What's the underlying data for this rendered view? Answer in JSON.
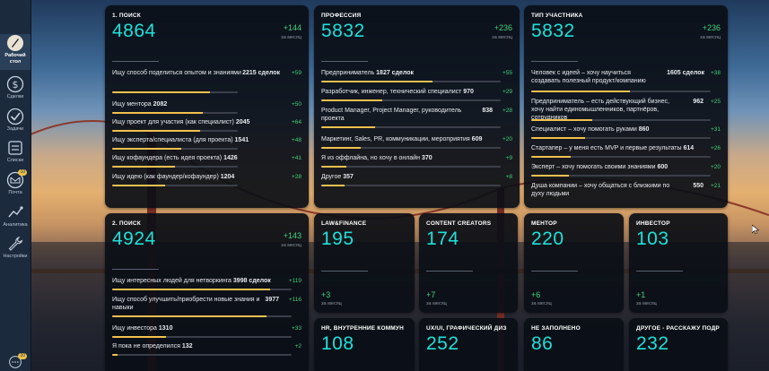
{
  "sidebar": {
    "items": [
      {
        "label": "Рабочий стол",
        "icon": "workspace-avatar-icon",
        "active": true
      },
      {
        "label": "Сделки",
        "icon": "dollar-icon"
      },
      {
        "label": "Задачи",
        "icon": "check-circle-icon"
      },
      {
        "label": "Списки",
        "icon": "list-icon"
      },
      {
        "label": "Почта",
        "icon": "mail-icon",
        "badge": "10"
      },
      {
        "label": "Аналитика",
        "icon": "analytics-icon"
      },
      {
        "label": "Настройки",
        "icon": "wrench-icon"
      },
      {
        "label": "",
        "icon": "chat-icon",
        "badge": "20"
      }
    ]
  },
  "cards": {
    "search1": {
      "title": "1. ПОИСК",
      "total": "4864",
      "delta": "+144",
      "period": "за месяц",
      "rows": [
        {
          "text": "Ищу способ поделиться опытом и знаниями",
          "count": "2215 сделок",
          "delta": "+59",
          "fill": 0.78
        },
        {
          "text": "Ищу ментора",
          "count": "2082",
          "delta": "+50",
          "fill": 0.72
        },
        {
          "text": "Ищу проект для участия (как специалист)",
          "count": "2045",
          "delta": "+64",
          "fill": 0.7
        },
        {
          "text": "Ищу эксперта/специалиста (для проекта)",
          "count": "1541",
          "delta": "+48",
          "fill": 0.55
        },
        {
          "text": "Ищу кофаундера (есть идея проекта)",
          "count": "1426",
          "delta": "+41",
          "fill": 0.5
        },
        {
          "text": "Ищу идею (как фаундер/кофаундер)",
          "count": "1204",
          "delta": "+28",
          "fill": 0.42
        }
      ]
    },
    "profession": {
      "title": "ПРОФЕССИЯ",
      "total": "5832",
      "delta": "+236",
      "period": "за месяц",
      "rows": [
        {
          "text": "Предприниматель",
          "count": "1827 сделок",
          "delta": "+55",
          "fill": 0.62
        },
        {
          "text": "Разработчик, инженер, технический специалист",
          "count": "970",
          "delta": "+29",
          "fill": 0.34
        },
        {
          "text": "Product Manager, Project Manager, руководитель проекта",
          "count": "838",
          "delta": "+28",
          "fill": 0.3
        },
        {
          "text": "Маркетинг, Sales, PR, коммуникации, мероприятия",
          "count": "609",
          "delta": "+20",
          "fill": 0.22
        },
        {
          "text": "Я из оффлайна, но хочу в онлайн",
          "count": "370",
          "delta": "+9",
          "fill": 0.14
        },
        {
          "text": "Другое",
          "count": "357",
          "delta": "+8",
          "fill": 0.13
        }
      ]
    },
    "participant": {
      "title": "ТИП УЧАСТНИКА",
      "total": "5832",
      "delta": "+236",
      "period": "за месяц",
      "rows": [
        {
          "text": "Человек с идеей – хочу научиться создавать полезный продукт/компанию",
          "count": "1605 сделок",
          "delta": "+38",
          "fill": 0.55
        },
        {
          "text": "Предприниматель – есть действующий бизнес, хочу найти единомышленников, партнёров, сотрудников",
          "count": "962",
          "delta": "+25",
          "fill": 0.34
        },
        {
          "text": "Специалист – хочу помогать руками",
          "count": "860",
          "delta": "+31",
          "fill": 0.3
        },
        {
          "text": "Стартапер – у меня есть MVP и первые результаты",
          "count": "614",
          "delta": "+26",
          "fill": 0.22
        },
        {
          "text": "Эксперт – хочу помогать своими знаниями",
          "count": "600",
          "delta": "+20",
          "fill": 0.21
        },
        {
          "text": "Душа компании – хочу общаться с близкими по духу людьми",
          "count": "550",
          "delta": "+21",
          "fill": 0.19
        }
      ]
    },
    "search2": {
      "title": "2. ПОИСК",
      "total": "4924",
      "delta": "+143",
      "period": "за месяц",
      "rows": [
        {
          "text": "Ищу интересных людей для нетворкинга",
          "count": "3998 сделок",
          "delta": "+119",
          "fill": 0.88
        },
        {
          "text": "Ищу способ улучшить/приобрести новые знания и навыки",
          "count": "3977",
          "delta": "+116",
          "fill": 0.86
        },
        {
          "text": "Ищу инвестора",
          "count": "1310",
          "delta": "+33",
          "fill": 0.3
        },
        {
          "text": "Я пока не определился",
          "count": "132",
          "delta": "+2",
          "fill": 0.03
        }
      ]
    },
    "small": [
      {
        "title": "LAW&FINANCE",
        "total": "195",
        "delta": "+3",
        "period": "за месяц"
      },
      {
        "title": "CONTENT CREATORS",
        "total": "174",
        "delta": "+7",
        "period": "за месяц"
      },
      {
        "title": "МЕНТОР",
        "total": "220",
        "delta": "+6",
        "period": "за месяц"
      },
      {
        "title": "ИНВЕСТОР",
        "total": "103",
        "delta": "+1",
        "period": "за месяц"
      },
      {
        "title": "HR, ВНУТРЕННИЕ КОММУН",
        "total": "108"
      },
      {
        "title": "UX/UI, ГРАФИЧЕСКИЙ ДИЗ",
        "total": "252"
      },
      {
        "title": "НЕ ЗАПОЛНЕНО",
        "total": "86"
      },
      {
        "title": "ДРУГОЕ - РАССКАЖУ ПОДР",
        "total": "232"
      }
    ]
  },
  "colors": {
    "accent": "#1fe0d8",
    "positive": "#44d27a",
    "bar": "#f2c14e",
    "card_bg": "#0a0e16"
  }
}
